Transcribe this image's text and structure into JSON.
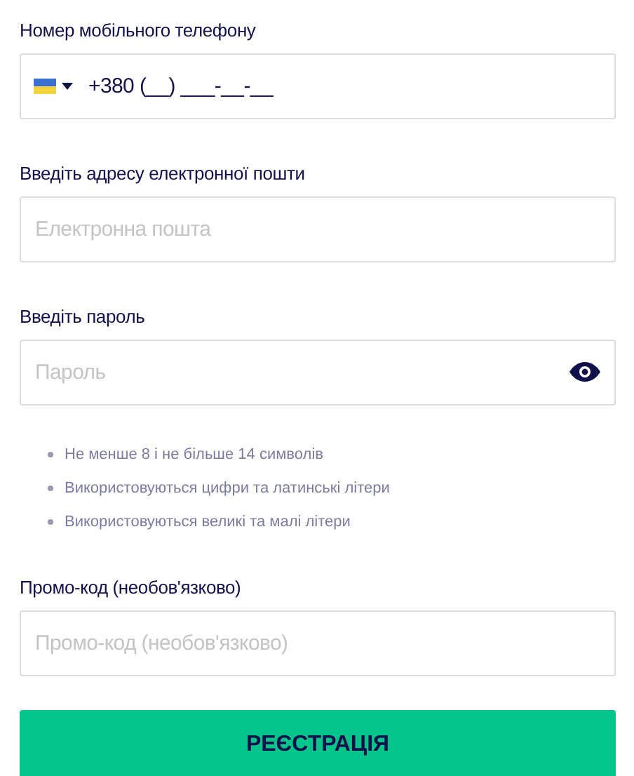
{
  "fields": [
    {
      "kind": "phone",
      "label": "Номер мобільного телефону",
      "value": "+380 (__) ___-__-__"
    },
    {
      "kind": "text",
      "label": "Введіть адресу електронної пошти",
      "placeholder": "Електронна пошта"
    },
    {
      "kind": "password",
      "label": "Введіть пароль",
      "placeholder": "Пароль",
      "rules": [
        "Не менше 8 і не більше 14 символів",
        "Використовуються цифри та латинські літери",
        "Використовуються великі та малі літери"
      ]
    },
    {
      "kind": "text",
      "label": "Промо-код (необов'язково)",
      "placeholder": "Промо-код (необов'язково)"
    }
  ],
  "submit": "РЕЄСТРАЦІЯ"
}
